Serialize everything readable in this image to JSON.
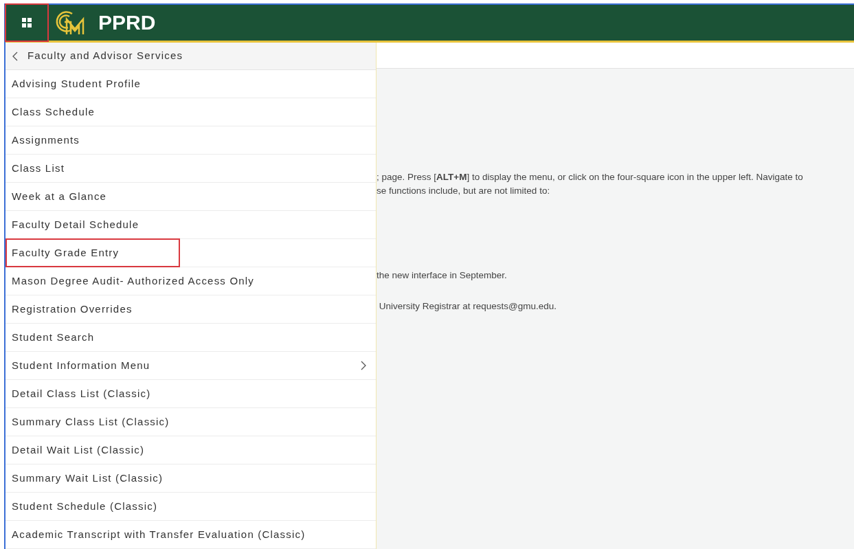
{
  "header": {
    "menu_button": {
      "highlighted": true
    },
    "title": "PPRD"
  },
  "menu": {
    "back_title": "Faculty and Advisor Services",
    "items": [
      {
        "label": "Advising Student Profile",
        "highlighted": false,
        "has_submenu": false
      },
      {
        "label": "Class Schedule",
        "highlighted": false,
        "has_submenu": false
      },
      {
        "label": "Assignments",
        "highlighted": false,
        "has_submenu": false
      },
      {
        "label": "Class List",
        "highlighted": false,
        "has_submenu": false
      },
      {
        "label": "Week at a Glance",
        "highlighted": false,
        "has_submenu": false
      },
      {
        "label": "Faculty Detail Schedule",
        "highlighted": false,
        "has_submenu": false
      },
      {
        "label": "Faculty Grade Entry",
        "highlighted": true,
        "has_submenu": false
      },
      {
        "label": "Mason Degree Audit- Authorized Access Only",
        "highlighted": false,
        "has_submenu": false
      },
      {
        "label": "Registration Overrides",
        "highlighted": false,
        "has_submenu": false
      },
      {
        "label": "Student Search",
        "highlighted": false,
        "has_submenu": false
      },
      {
        "label": "Student Information Menu",
        "highlighted": false,
        "has_submenu": true
      },
      {
        "label": "Detail Class List (Classic)",
        "highlighted": false,
        "has_submenu": false
      },
      {
        "label": "Summary Class List (Classic)",
        "highlighted": false,
        "has_submenu": false
      },
      {
        "label": "Detail Wait List (Classic)",
        "highlighted": false,
        "has_submenu": false
      },
      {
        "label": "Summary Wait List (Classic)",
        "highlighted": false,
        "has_submenu": false
      },
      {
        "label": "Student Schedule (Classic)",
        "highlighted": false,
        "has_submenu": false
      },
      {
        "label": "Academic Transcript with Transfer Evaluation (Classic)",
        "highlighted": false,
        "has_submenu": false
      }
    ]
  },
  "content": {
    "paragraphs": [
      {
        "lines": [
          "; page. Press [**ALT+M**] to display the menu, or click on the four-square icon in the upper left. Navigate to",
          "se functions include, but are not limited to:"
        ]
      },
      {
        "lines": [
          "the new interface in September."
        ]
      },
      {
        "lines": [
          " University Registrar at requests@gmu.edu."
        ]
      }
    ]
  }
}
